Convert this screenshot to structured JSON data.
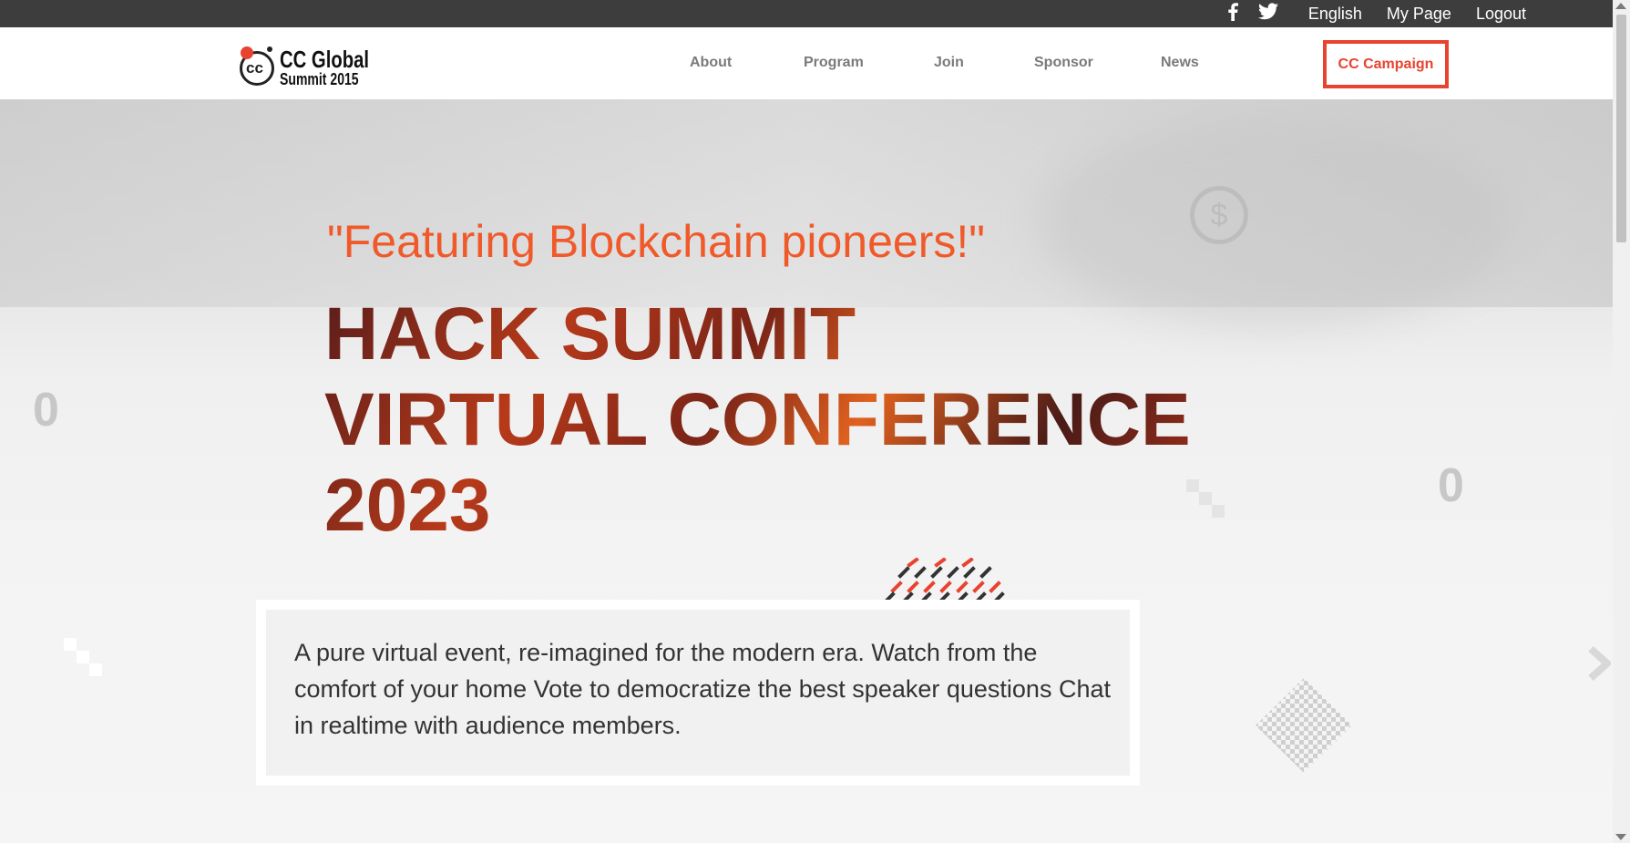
{
  "topbar": {
    "social": [
      "facebook-icon",
      "twitter-icon"
    ],
    "language": "English",
    "my_page": "My Page",
    "logout": "Logout"
  },
  "logo": {
    "mark": "cc",
    "line1": "CC Global",
    "line2": "Summit 2015"
  },
  "nav": {
    "items": [
      "About",
      "Program",
      "Join",
      "Sponsor",
      "News"
    ],
    "campaign": "CC Campaign"
  },
  "hero": {
    "tagline": "\"Featuring Blockchain pioneers!\"",
    "headline": [
      "HACK SUMMIT",
      "VIRTUAL CONFERENCE",
      "2023"
    ],
    "description": "A pure virtual event, re-imagined for the modern era. Watch from the comfort of your home Vote to democratize the best speaker questions Chat in realtime with audience members."
  },
  "colors": {
    "accent": "#e8432f",
    "tagline": "#f05a2a",
    "topbar": "#3d3d3d"
  }
}
